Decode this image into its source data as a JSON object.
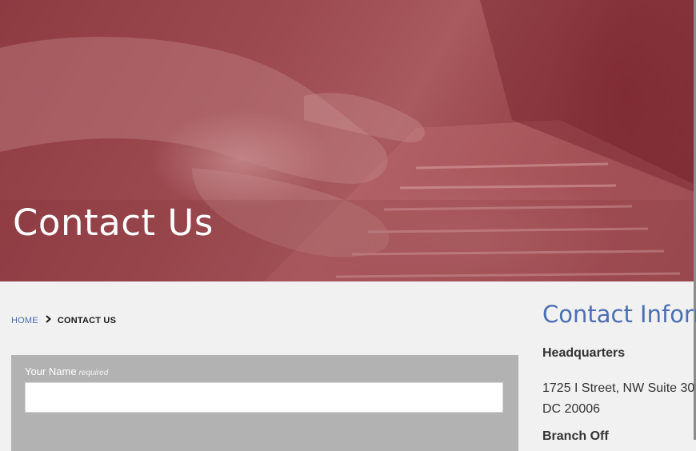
{
  "hero": {
    "title": "Contact Us"
  },
  "breadcrumb": {
    "home": "HOME",
    "current": "CONTACT US"
  },
  "form": {
    "name_label": "Your Name",
    "name_required": "required",
    "name_value": ""
  },
  "contact_info": {
    "title": "Contact Inform",
    "headquarters_heading": "Headquarters",
    "address_line1": "1725 I Street, NW Suite 30",
    "address_line2": "DC 20006",
    "branch_heading": "Branch Off"
  },
  "colors": {
    "hero_overlay": "#9a4349",
    "link_blue": "#4a6fb3",
    "form_panel": "#b2b2b2",
    "page_bg": "#f1f1f1"
  },
  "icons": {
    "breadcrumb_separator": "chevron-right-icon"
  }
}
